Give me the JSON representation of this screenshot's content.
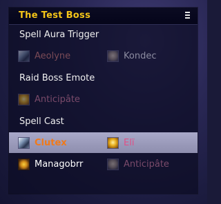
{
  "window": {
    "title": "The Test Boss",
    "menu_icon": "hamburger-icon"
  },
  "sections": {
    "spell_aura_trigger": {
      "heading": "Spell Aura Trigger",
      "left": {
        "name": "Aeolyne",
        "icon": "storm-icon"
      },
      "right": {
        "name": "Kondec",
        "icon": "portrait-icon"
      }
    },
    "raid_boss_emote": {
      "heading": "Raid Boss Emote",
      "left": {
        "name": "Anticipâte",
        "icon": "golden-glow-icon"
      }
    },
    "spell_cast": {
      "heading": "Spell Cast",
      "rows": [
        {
          "selected": true,
          "left": {
            "name": "Clutex",
            "icon": "storm-icon"
          },
          "right": {
            "name": "Elï",
            "icon": "golden-glow-icon"
          }
        },
        {
          "selected": false,
          "left": {
            "name": "Managobrr",
            "icon": "skull-icon"
          },
          "right": {
            "name": "Anticipâte",
            "icon": "portrait-icon"
          }
        }
      ]
    }
  },
  "colors": {
    "title": "#f5c518",
    "selected_row": "#9d9dbd",
    "orange_name": "#f07a1a",
    "pink_name": "#e04f86",
    "dimmed_name": "#7a4a56"
  }
}
